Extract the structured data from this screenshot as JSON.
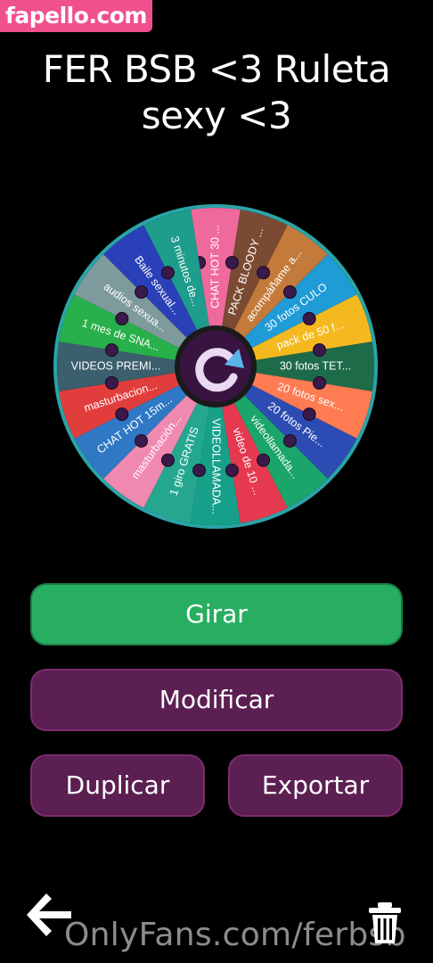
{
  "watermark_top": "fapello.com",
  "title": "FER BSB <3 Ruleta sexy <3",
  "wheel": {
    "segments": [
      {
        "label": "CHAT HOT 30 ...",
        "color": "#ee6a9c"
      },
      {
        "label": "PACK BLOODY ...",
        "color": "#7a4a32"
      },
      {
        "label": "acompáñame a...",
        "color": "#c47a3a"
      },
      {
        "label": "30 fotos CULO",
        "color": "#1f9bd6"
      },
      {
        "label": "pack de 50 f...",
        "color": "#f4b91f"
      },
      {
        "label": "30 fotos TET...",
        "color": "#1e6b4a"
      },
      {
        "label": "20 fotos sex...",
        "color": "#ff7b52"
      },
      {
        "label": "20 fotos Pie...",
        "color": "#2d4cb3"
      },
      {
        "label": "videollamada...",
        "color": "#1aa56b"
      },
      {
        "label": "video de 10 ...",
        "color": "#e53950"
      },
      {
        "label": "VIDEOLLAMADA...",
        "color": "#16a08a"
      },
      {
        "label": "1 giro GRATIS",
        "color": "#25a78f"
      },
      {
        "label": "masturbación...",
        "color": "#f089b0"
      },
      {
        "label": "CHAT HOT 15m...",
        "color": "#2f78c4"
      },
      {
        "label": "masturbacion...",
        "color": "#e23d3d"
      },
      {
        "label": "VIDEOS PREMI...",
        "color": "#3b5f6c"
      },
      {
        "label": "1 mes de SNA...",
        "color": "#28b04a"
      },
      {
        "label": "audios sexua...",
        "color": "#7f9a9c"
      },
      {
        "label": "Baile sexual...",
        "color": "#2a40b8"
      },
      {
        "label": "3 minutos de...",
        "color": "#1e9c8c"
      }
    ],
    "rim_color": "#2aa4a8",
    "hub_color": "#3a1440",
    "spin_icon": "refresh-icon"
  },
  "buttons": {
    "spin": "Girar",
    "modify": "Modificar",
    "duplicate": "Duplicar",
    "export": "Exportar"
  },
  "icons": {
    "back": "back-arrow-icon",
    "delete": "trash-icon"
  },
  "watermark_bottom": "OnlyFans.com/ferbsb"
}
